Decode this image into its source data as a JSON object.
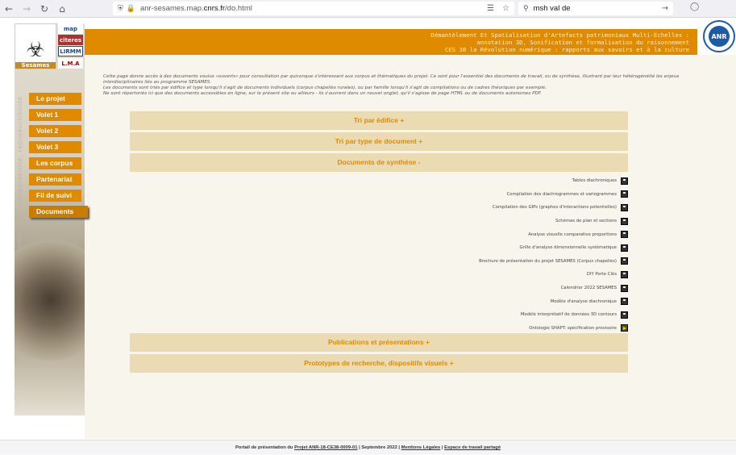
{
  "browser": {
    "url_prefix": "anr-sesames.map.",
    "url_domain": "cnrs.fr",
    "url_path": "/do.html",
    "search_query": "msh val de"
  },
  "header": {
    "banner_lines": [
      "Démantèlement Et Spatialisation d'Artefacts patrimoniaux Multi-Échelles :",
      "annotation 3D, Sonification et formalisation du raisonnement",
      "CES 38 la Révolution numérique : rapports aux savoirs et à la culture"
    ],
    "logo_label": "Sesames",
    "partner_logos": [
      "map",
      "citeres",
      "LIRMM",
      "L.M.A"
    ],
    "anr_label": "ANR"
  },
  "sidebar": {
    "vertical_text": "intégration  |  formalisation, comparabilité, reproductibilité",
    "items": [
      {
        "label": "Le projet"
      },
      {
        "label": "Volet 1"
      },
      {
        "label": "Volet 2"
      },
      {
        "label": "Volet 3"
      },
      {
        "label": "Les corpus"
      },
      {
        "label": "Partenariat"
      },
      {
        "label": "Fil de suivi"
      },
      {
        "label": "Documents",
        "active": true
      }
    ]
  },
  "intro": {
    "line1": "Cette page donne accès à des documents voulus «ouverts» pour consultation par quiconque s'intéressant aux corpus et thématiques du projet. Ce sont pour l'essentiel des documents de travail, ou de synthèse, illustrant par leur hétérogénéité les enjeux",
    "line2": "interdisciplinaires liés au programme SESAMES.",
    "line3": "Les documents sont triés par édifice et type lorsqu'il s'agit de documents individuels (corpus chapelles rurales), ou par famille lorsqu'il s'agit de compilations ou de cadres théoriques par exemple.",
    "line4": "Ne sont répertoriés ici que des documents accessibles en ligne, sur le présent site ou ailleurs - ils s'ouvrent dans un nouvel onglet, qu'il s'agisse de page HTML ou de documents autonomes PDF."
  },
  "sections": {
    "tri_edifice": "Tri par édifice +",
    "tri_type": "Tri par type de document +",
    "synthese": "Documents de synthèse -",
    "publications": "Publications et présentations +",
    "prototypes": "Prototypes de recherche, dispositifs visuels +"
  },
  "documents": [
    {
      "label": "Tables diachroniques"
    },
    {
      "label": "Compilation des diachrogrammes et variogrammes"
    },
    {
      "label": "Compilation des GIPs (graphes d'interactions potentielles)"
    },
    {
      "label": "Schémas de plan et sections"
    },
    {
      "label": "Analyse visuelle comparative proportions"
    },
    {
      "label": "Grille d'analyse dimensionnelle systématique"
    },
    {
      "label": "Brochure de présentation du projet SESAMES (Corpus chapelles)"
    },
    {
      "label": "DIY Porte Clés"
    },
    {
      "label": "Calendrier 2022 SESAMES"
    },
    {
      "label": "Modèle d'analyse diachronique"
    },
    {
      "label": "Modèle interprétatif de données 3D contours"
    },
    {
      "label": "Ontologie SHAPT: spécification provisoire"
    }
  ],
  "footer": {
    "prefix": "Portail de présentation du",
    "project_link": "Projet ANR-18-CE38-0009-01",
    "date": "Septembre 2022",
    "legal_link": "Mentions Légales",
    "workspace_link": "Espace de travail partagé"
  }
}
